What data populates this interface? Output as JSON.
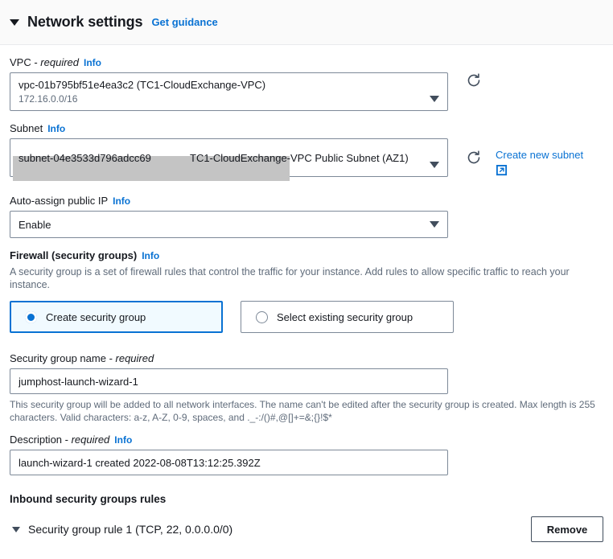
{
  "header": {
    "title": "Network settings",
    "guidance_link": "Get guidance",
    "collapse_icon": "caret-down-icon"
  },
  "vpc": {
    "label": "VPC - ",
    "label_required": "required",
    "info": "Info",
    "value_primary": "vpc-01b795bf51e4ea3c2 (TC1-CloudExchange-VPC)",
    "value_secondary": "172.16.0.0/16",
    "refresh_icon": "refresh-icon"
  },
  "subnet": {
    "label": "Subnet",
    "info": "Info",
    "value_id": "subnet-04e3533d796adcc69",
    "value_name": "TC1-CloudExchange-VPC Public Subnet (AZ1)",
    "refresh_icon": "refresh-icon",
    "create_link": "Create new subnet",
    "external_icon": "external-link-icon"
  },
  "auto_assign_ip": {
    "label": "Auto-assign public IP",
    "info": "Info",
    "value": "Enable"
  },
  "firewall": {
    "label": "Firewall (security groups)",
    "info": "Info",
    "description": "A security group is a set of firewall rules that control the traffic for your instance. Add rules to allow specific traffic to reach your instance.",
    "options": [
      {
        "label": "Create security group",
        "selected": true
      },
      {
        "label": "Select existing security group",
        "selected": false
      }
    ]
  },
  "security_group_name": {
    "label": "Security group name - ",
    "label_required": "required",
    "value": "jumphost-launch-wizard-1",
    "hint": "This security group will be added to all network interfaces. The name can't be edited after the security group is created. Max length is 255 characters. Valid characters: a-z, A-Z, 0-9, spaces, and ._-:/()#,@[]+=&;{}!$*"
  },
  "description_field": {
    "label": "Description - ",
    "label_required": "required",
    "info": "Info",
    "value": "launch-wizard-1 created 2022-08-08T13:12:25.392Z"
  },
  "inbound_rules": {
    "title": "Inbound security groups rules",
    "rules": [
      {
        "label": "Security group rule 1 (TCP, 22, 0.0.0.0/0)",
        "remove_label": "Remove",
        "expand_icon": "caret-down-icon"
      }
    ]
  },
  "colors": {
    "accent": "#0972d3",
    "border": "#7d8998",
    "text": "#16191f",
    "muted": "#5f6b7a",
    "header_bg": "#fafafa",
    "tile_selected_bg": "#f1faff",
    "redaction": "#c4c4c4"
  }
}
